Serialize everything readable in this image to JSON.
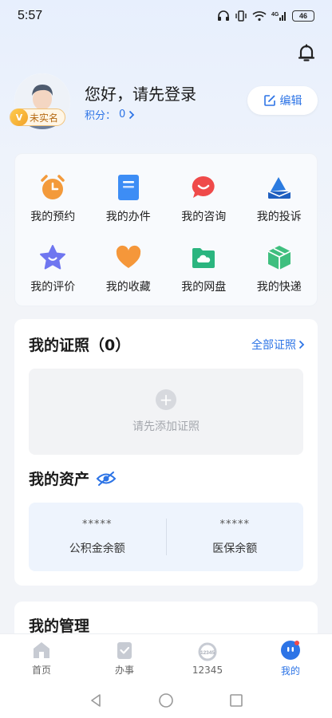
{
  "status": {
    "time": "5:57",
    "battery": "46",
    "network": "4G"
  },
  "profile": {
    "verify_badge": "未实名",
    "greeting": "您好，请先登录",
    "points_label": "积分：",
    "points_value": "0",
    "edit_label": "编辑"
  },
  "services": [
    {
      "label": "我的预约",
      "icon": "alarm-clock-icon",
      "color": "#f39a3b"
    },
    {
      "label": "我的办件",
      "icon": "document-icon",
      "color": "#3d8df5"
    },
    {
      "label": "我的咨询",
      "icon": "chat-bubble-icon",
      "color": "#ef4a4a"
    },
    {
      "label": "我的投诉",
      "icon": "envelope-icon",
      "color": "#2b7be0"
    },
    {
      "label": "我的评价",
      "icon": "star-icon",
      "color": "#6f76f0"
    },
    {
      "label": "我的收藏",
      "icon": "heart-icon",
      "color": "#f5973a"
    },
    {
      "label": "我的网盘",
      "icon": "folder-cloud-icon",
      "color": "#2bb57f"
    },
    {
      "label": "我的快递",
      "icon": "package-icon",
      "color": "#3fbf7f"
    }
  ],
  "certificates": {
    "title": "我的证照（0）",
    "all_link": "全部证照",
    "empty_text": "请先添加证照"
  },
  "assets": {
    "title": "我的资产",
    "items": [
      {
        "mask": "*****",
        "label": "公积金余额"
      },
      {
        "mask": "*****",
        "label": "医保余额"
      }
    ]
  },
  "management": {
    "title": "我的管理"
  },
  "tabbar": {
    "tabs": [
      {
        "label": "首页",
        "icon": "home-icon"
      },
      {
        "label": "办事",
        "icon": "task-icon"
      },
      {
        "label": "12345",
        "icon": "hotline-icon"
      },
      {
        "label": "我的",
        "icon": "profile-face-icon",
        "active": true
      }
    ]
  },
  "colors": {
    "accent": "#2d74e6",
    "background": "#f2f4f8"
  }
}
